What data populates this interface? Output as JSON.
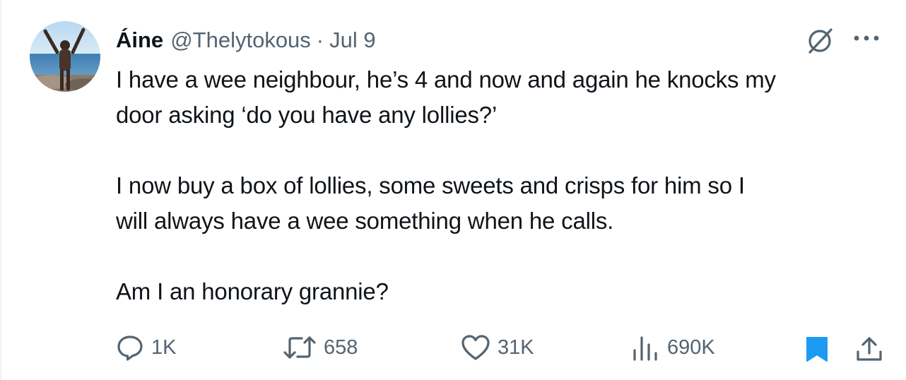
{
  "author": {
    "name": "Áine",
    "handle": "@Thelytokous",
    "separator": "·",
    "date": "Jul 9"
  },
  "tweet": {
    "lines": [
      "I have a wee neighbour, he’s 4 and now and again he knocks my",
      "door asking ‘do you have any lollies?’",
      "I now buy a box of lollies, some sweets and crisps for him so I",
      "will always have a wee something when he calls.",
      "Am I an honorary grannie?"
    ]
  },
  "actions": {
    "replies": "1K",
    "reposts": "658",
    "likes": "31K",
    "views": "690K"
  },
  "icons": [
    "avatar",
    "grok-icon",
    "more-icon",
    "reply-icon",
    "repost-icon",
    "like-icon",
    "views-icon",
    "bookmark-icon",
    "share-icon"
  ],
  "colors": {
    "text": "#0f1419",
    "secondary": "#536471",
    "bookmark": "#1d9bf0"
  }
}
